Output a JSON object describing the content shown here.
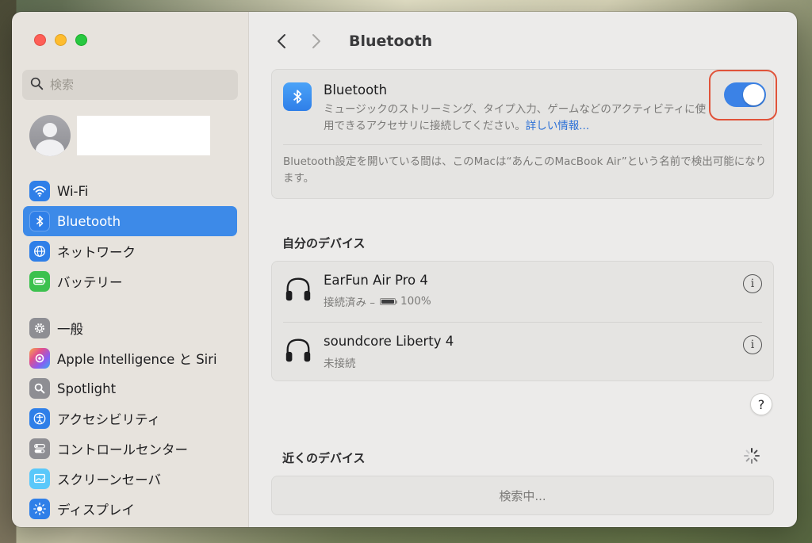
{
  "sidebar": {
    "search_placeholder": "検索",
    "items": [
      {
        "label": "Wi-Fi",
        "icon": "wifi-icon",
        "color": "#2f7fe8"
      },
      {
        "label": "Bluetooth",
        "icon": "bluetooth-icon",
        "color": "#2f7fe8",
        "active": true
      },
      {
        "label": "ネットワーク",
        "icon": "globe-icon",
        "color": "#2f7fe8"
      },
      {
        "label": "バッテリー",
        "icon": "battery-icon",
        "color": "#3cc14e"
      },
      {
        "label": "一般",
        "icon": "gear-icon",
        "color": "#8e8e93"
      },
      {
        "label": "Apple Intelligence と Siri",
        "icon": "siri-icon",
        "color": "#c95cf0"
      },
      {
        "label": "Spotlight",
        "icon": "magnifier-icon",
        "color": "#8e8e93"
      },
      {
        "label": "アクセシビリティ",
        "icon": "accessibility-icon",
        "color": "#2f7fe8"
      },
      {
        "label": "コントロールセンター",
        "icon": "toggles-icon",
        "color": "#8e8e93"
      },
      {
        "label": "スクリーンセーバ",
        "icon": "screensaver-icon",
        "color": "#5ac8fa"
      },
      {
        "label": "ディスプレイ",
        "icon": "sun-icon",
        "color": "#2f7fe8"
      }
    ]
  },
  "header": {
    "title": "Bluetooth"
  },
  "bluetooth": {
    "title": "Bluetooth",
    "description": "ミュージックのストリーミング、タイプ入力、ゲームなどのアクティビティに使用できるアクセサリに接続してください。",
    "link": "詳しい情報...",
    "enabled": true,
    "note": "Bluetooth設定を開いている間は、このMacは“あんこのMacBook Air”という名前で検出可能になります。"
  },
  "my_devices": {
    "title": "自分のデバイス",
    "devices": [
      {
        "name": "EarFun Air Pro 4",
        "status": "接続済み –",
        "battery": "100%",
        "battery_level": 1.0
      },
      {
        "name": "soundcore Liberty 4",
        "status": "未接続"
      }
    ]
  },
  "help_label": "?",
  "nearby": {
    "title": "近くのデバイス",
    "searching": "検索中..."
  },
  "colors": {
    "accent": "#3b82e6",
    "highlight_ring": "#e0533a"
  }
}
